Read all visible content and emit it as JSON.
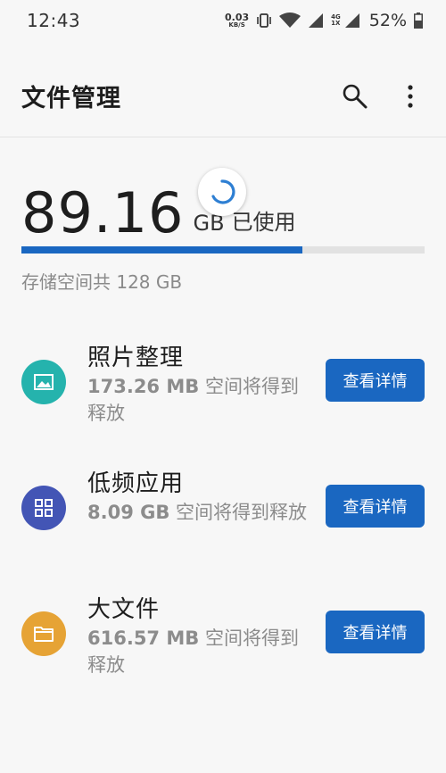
{
  "status_bar": {
    "time": "12:43",
    "net_speed": "0.03",
    "net_unit": "KB/S",
    "net_type_top": "4G",
    "net_type_bottom": "1X",
    "battery": "52%"
  },
  "app_bar": {
    "title": "文件管理",
    "icons": [
      "search-icon",
      "more-vert-icon"
    ]
  },
  "storage": {
    "used_value": "89.16",
    "used_unit": "GB",
    "used_label": "已使用",
    "total_text": "存储空间共 128 GB",
    "used_fraction": 0.6966
  },
  "items": [
    {
      "title": "照片整理",
      "size": "173.26 MB",
      "desc": " 空间将得到释放",
      "button": "查看详情",
      "icon": "image-icon",
      "color": "#25b3ad"
    },
    {
      "title": "低频应用",
      "size": "8.09 GB",
      "desc": " 空间将得到释放",
      "button": "查看详情",
      "icon": "grid-icon",
      "color": "#4355b5"
    },
    {
      "title": "大文件",
      "size": "616.57 MB",
      "desc": " 空间将得到释放",
      "button": "查看详情",
      "icon": "folder-icon",
      "color": "#e6a335"
    }
  ],
  "colors": {
    "accent": "#1a67c1",
    "track": "#e2e2e2"
  }
}
